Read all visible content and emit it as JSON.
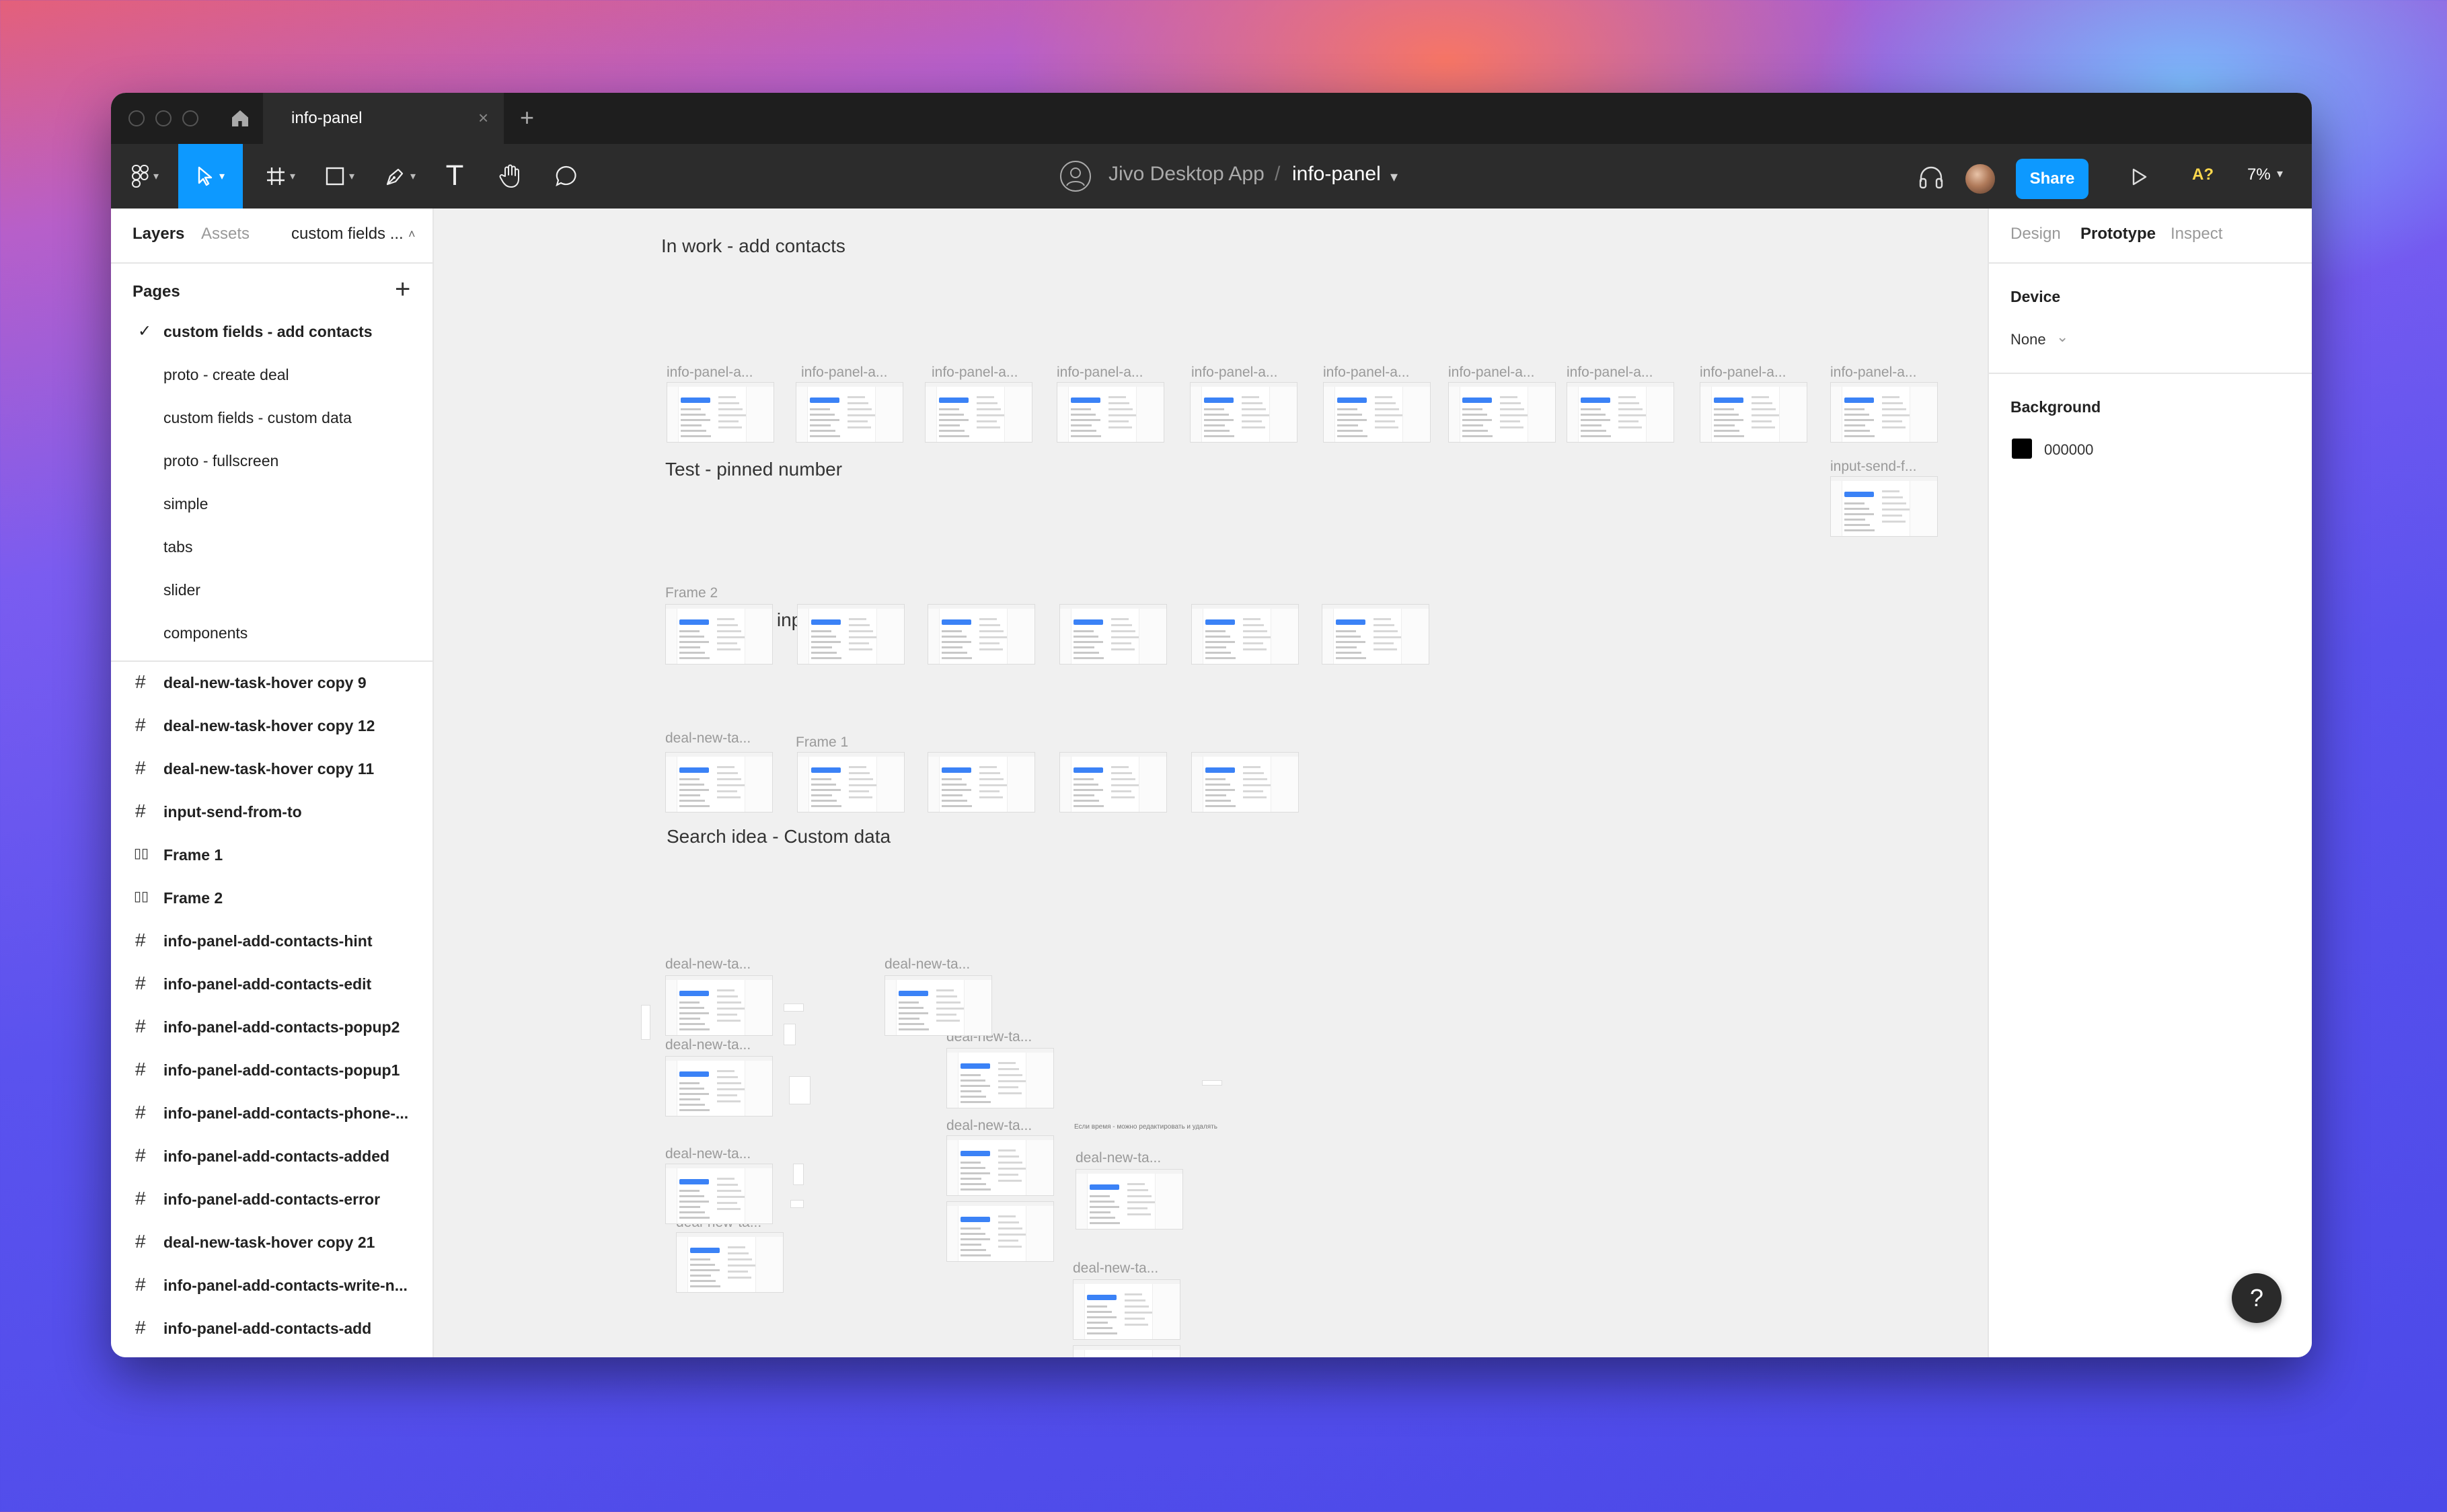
{
  "titlebar": {
    "tab_title": "info-panel",
    "close_glyph": "×",
    "new_tab_glyph": "+"
  },
  "toolbar": {
    "team": "Jivo Desktop App",
    "separator": "/",
    "file": "info-panel",
    "share_label": "Share",
    "a11y_label": "A?",
    "zoom": "7%",
    "text_tool_glyph": "T"
  },
  "left_panel": {
    "tabs": [
      "Layers",
      "Assets"
    ],
    "page_dropdown": "custom fields ...",
    "pages_heading": "Pages",
    "pages": [
      {
        "label": "custom fields - add contacts",
        "selected": true
      },
      {
        "label": "proto - create deal",
        "selected": false
      },
      {
        "label": "custom fields - custom data",
        "selected": false
      },
      {
        "label": "proto - fullscreen",
        "selected": false
      },
      {
        "label": "simple",
        "selected": false
      },
      {
        "label": "tabs",
        "selected": false
      },
      {
        "label": "slider",
        "selected": false
      },
      {
        "label": "components",
        "selected": false
      }
    ],
    "layers": [
      {
        "label": "deal-new-task-hover copy 9",
        "icon": "frame-icon"
      },
      {
        "label": "deal-new-task-hover copy 12",
        "icon": "frame-icon"
      },
      {
        "label": "deal-new-task-hover copy 11",
        "icon": "frame-icon"
      },
      {
        "label": "input-send-from-to",
        "icon": "frame-icon"
      },
      {
        "label": "Frame 1",
        "icon": "columns-icon"
      },
      {
        "label": "Frame 2",
        "icon": "columns-icon"
      },
      {
        "label": "info-panel-add-contacts-hint",
        "icon": "frame-icon"
      },
      {
        "label": "info-panel-add-contacts-edit",
        "icon": "frame-icon"
      },
      {
        "label": "info-panel-add-contacts-popup2",
        "icon": "frame-icon"
      },
      {
        "label": "info-panel-add-contacts-popup1",
        "icon": "frame-icon"
      },
      {
        "label": "info-panel-add-contacts-phone-...",
        "icon": "frame-icon"
      },
      {
        "label": "info-panel-add-contacts-added",
        "icon": "frame-icon"
      },
      {
        "label": "info-panel-add-contacts-error",
        "icon": "frame-icon"
      },
      {
        "label": "deal-new-task-hover copy 21",
        "icon": "frame-icon"
      },
      {
        "label": "info-panel-add-contacts-write-n...",
        "icon": "frame-icon"
      },
      {
        "label": "info-panel-add-contacts-add",
        "icon": "frame-icon"
      }
    ],
    "frame_glyph": "#",
    "columns_glyph": "▯▯",
    "check_glyph": "✓",
    "plus_glyph": "+"
  },
  "right_panel": {
    "tabs": [
      "Design",
      "Prototype",
      "Inspect"
    ],
    "active_tab": "Prototype",
    "device_label": "Device",
    "device_value": "None",
    "background_label": "Background",
    "background_hex": "000000",
    "chevron_glyph": "⌄"
  },
  "canvas": {
    "sections": [
      "In work - add contacts",
      "Test - pinned number",
      "Test - phone input",
      "Search idea - Custom data"
    ],
    "frame_labels": {
      "row1": [
        "info-panel-a...",
        "info-panel-a...",
        "info-panel-a...",
        "info-panel-a...",
        "info-panel-a...",
        "info-panel-a...",
        "info-panel-a...",
        "info-panel-a...",
        "info-panel-a...",
        "info-panel-a..."
      ],
      "row1_extra": "input-send-f...",
      "row2": "Frame 2",
      "row3": [
        "deal-new-ta...",
        "Frame 1"
      ],
      "search": [
        "deal-new-ta...",
        "deal-new-ta...",
        "deal-new-ta...",
        "deal-new-ta...",
        "deal-new-ta...",
        "deal-new-ta...",
        "deal-new-ta...",
        "deal-new-ta...",
        "deal-new-ta...",
        "deal-new-ta...",
        "deal-new-ta..."
      ]
    },
    "note_text": "Если время - можно редактировать и удалять"
  },
  "help_label": "?",
  "colors": {
    "accent": "#0d99ff",
    "toolbar": "#2c2c2c",
    "canvas": "#f0f0f0"
  }
}
